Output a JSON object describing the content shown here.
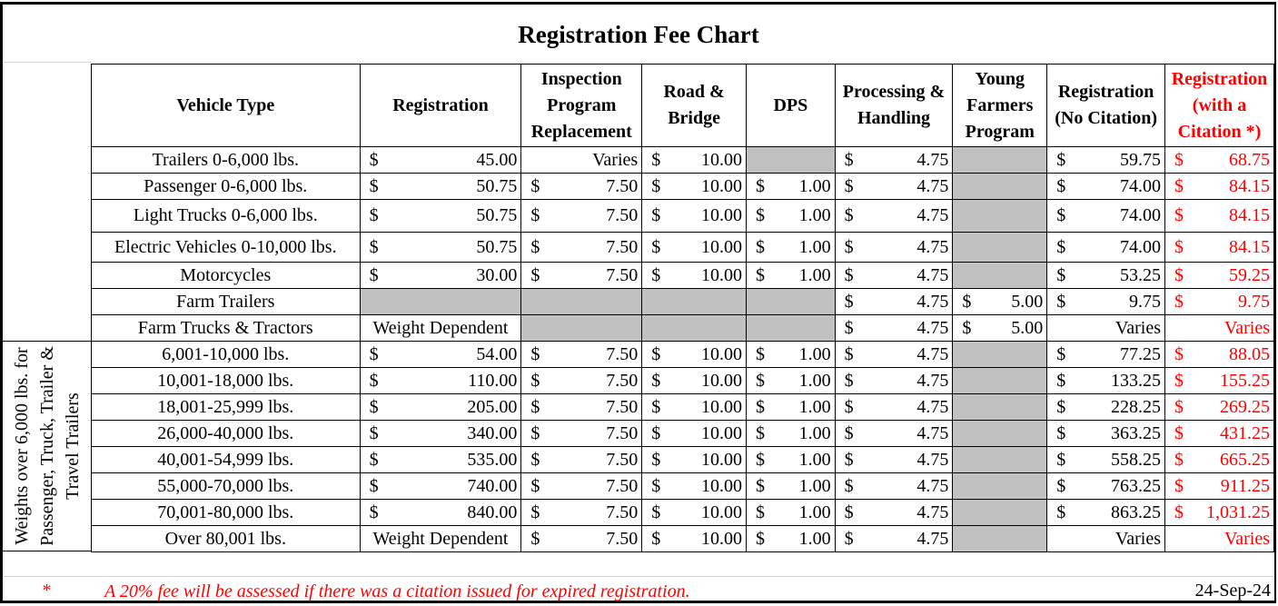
{
  "title": "Registration Fee Chart",
  "headers": {
    "vehicle_type": "Vehicle Type",
    "registration": "Registration",
    "inspection": "Inspection Program Replacement",
    "road_bridge": "Road & Bridge",
    "dps": "DPS",
    "processing": "Processing & Handling",
    "young_farmers": "Young Farmers Program",
    "reg_no_citation": "Registration (No Citation)",
    "reg_with_citation": "Registration (with a Citation *)"
  },
  "currency_symbol": "$",
  "side_group_label": "Weights over 6,000 lbs. for Passenger, Truck, Trailer & Travel Trailers",
  "rows": [
    {
      "vehicle_type": "Trailers 0-6,000 lbs.",
      "registration": "45.00",
      "inspection": "Varies",
      "road_bridge": "10.00",
      "dps": null,
      "processing": "4.75",
      "young_farmers": null,
      "reg_no_citation": "59.75",
      "reg_with_citation": "68.75"
    },
    {
      "vehicle_type": "Passenger 0-6,000 lbs.",
      "registration": "50.75",
      "inspection": "7.50",
      "road_bridge": "10.00",
      "dps": "1.00",
      "processing": "4.75",
      "young_farmers": null,
      "reg_no_citation": "74.00",
      "reg_with_citation": "84.15"
    },
    {
      "vehicle_type": "Light Trucks 0-6,000 lbs.",
      "registration": "50.75",
      "inspection": "7.50",
      "road_bridge": "10.00",
      "dps": "1.00",
      "processing": "4.75",
      "young_farmers": null,
      "reg_no_citation": "74.00",
      "reg_with_citation": "84.15"
    },
    {
      "vehicle_type": "Electric Vehicles 0-10,000 lbs.",
      "registration": "50.75",
      "inspection": "7.50",
      "road_bridge": "10.00",
      "dps": "1.00",
      "processing": "4.75",
      "young_farmers": null,
      "reg_no_citation": "74.00",
      "reg_with_citation": "84.15"
    },
    {
      "vehicle_type": "Motorcycles",
      "registration": "30.00",
      "inspection": "7.50",
      "road_bridge": "10.00",
      "dps": "1.00",
      "processing": "4.75",
      "young_farmers": null,
      "reg_no_citation": "53.25",
      "reg_with_citation": "59.25"
    },
    {
      "vehicle_type": "Farm Trailers",
      "registration": null,
      "inspection": null,
      "road_bridge": null,
      "dps": null,
      "processing": "4.75",
      "young_farmers": "5.00",
      "reg_no_citation": "9.75",
      "reg_with_citation": "9.75"
    },
    {
      "vehicle_type": "Farm Trucks & Tractors",
      "registration": "Weight Dependent",
      "inspection": null,
      "road_bridge": null,
      "dps": null,
      "processing": "4.75",
      "young_farmers": "5.00",
      "reg_no_citation": "Varies",
      "reg_with_citation": "Varies"
    },
    {
      "vehicle_type": "6,001-10,000 lbs.",
      "registration": "54.00",
      "inspection": "7.50",
      "road_bridge": "10.00",
      "dps": "1.00",
      "processing": "4.75",
      "young_farmers": null,
      "reg_no_citation": "77.25",
      "reg_with_citation": "88.05"
    },
    {
      "vehicle_type": "10,001-18,000 lbs.",
      "registration": "110.00",
      "inspection": "7.50",
      "road_bridge": "10.00",
      "dps": "1.00",
      "processing": "4.75",
      "young_farmers": null,
      "reg_no_citation": "133.25",
      "reg_with_citation": "155.25"
    },
    {
      "vehicle_type": "18,001-25,999 lbs.",
      "registration": "205.00",
      "inspection": "7.50",
      "road_bridge": "10.00",
      "dps": "1.00",
      "processing": "4.75",
      "young_farmers": null,
      "reg_no_citation": "228.25",
      "reg_with_citation": "269.25"
    },
    {
      "vehicle_type": "26,000-40,000 lbs.",
      "registration": "340.00",
      "inspection": "7.50",
      "road_bridge": "10.00",
      "dps": "1.00",
      "processing": "4.75",
      "young_farmers": null,
      "reg_no_citation": "363.25",
      "reg_with_citation": "431.25"
    },
    {
      "vehicle_type": "40,001-54,999 lbs.",
      "registration": "535.00",
      "inspection": "7.50",
      "road_bridge": "10.00",
      "dps": "1.00",
      "processing": "4.75",
      "young_farmers": null,
      "reg_no_citation": "558.25",
      "reg_with_citation": "665.25"
    },
    {
      "vehicle_type": "55,000-70,000 lbs.",
      "registration": "740.00",
      "inspection": "7.50",
      "road_bridge": "10.00",
      "dps": "1.00",
      "processing": "4.75",
      "young_farmers": null,
      "reg_no_citation": "763.25",
      "reg_with_citation": "911.25"
    },
    {
      "vehicle_type": "70,001-80,000 lbs.",
      "registration": "840.00",
      "inspection": "7.50",
      "road_bridge": "10.00",
      "dps": "1.00",
      "processing": "4.75",
      "young_farmers": null,
      "reg_no_citation": "863.25",
      "reg_with_citation": "1,031.25"
    },
    {
      "vehicle_type": "Over 80,001 lbs.",
      "registration": "Weight Dependent",
      "inspection": "7.50",
      "road_bridge": "10.00",
      "dps": "1.00",
      "processing": "4.75",
      "young_farmers": null,
      "reg_no_citation": "Varies",
      "reg_with_citation": "Varies"
    }
  ],
  "footnote": {
    "marker": "*",
    "text": "A 20% fee will be assessed if there was a citation issued for expired registration.",
    "date": "24-Sep-24"
  },
  "colors": {
    "citation_red": "#ff0000",
    "na_gray": "#c0c0c0"
  }
}
